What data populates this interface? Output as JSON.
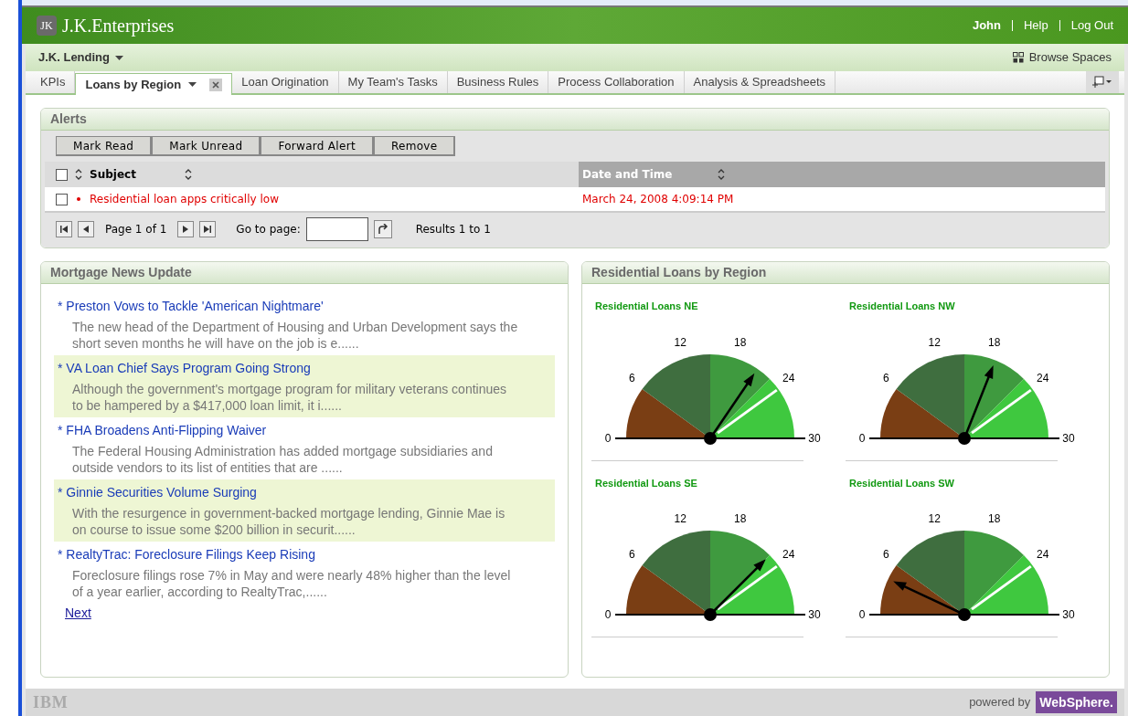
{
  "header": {
    "logo_mark": "JK",
    "brand": "J.K.Enterprises",
    "user": "John",
    "links": [
      "Help",
      "Log Out"
    ]
  },
  "space": {
    "title": "J.K. Lending",
    "browse": "Browse Spaces"
  },
  "tabs": [
    {
      "label": "KPIs",
      "selected": false
    },
    {
      "label": "Loans by Region",
      "selected": true
    },
    {
      "label": "Loan Origination",
      "selected": false
    },
    {
      "label": "My Team's Tasks",
      "selected": false
    },
    {
      "label": "Business Rules",
      "selected": false
    },
    {
      "label": "Process Collaboration",
      "selected": false
    },
    {
      "label": "Analysis & Spreadsheets",
      "selected": false
    }
  ],
  "alerts": {
    "title": "Alerts",
    "buttons": [
      "Mark Read",
      "Mark Unread",
      "Forward Alert",
      "Remove"
    ],
    "select_all": {
      "checked": false
    },
    "columns": [
      "Subject",
      "Date and Time"
    ],
    "rows": [
      {
        "checked": false,
        "subject": "Residential loan apps critically low",
        "date": "March 24, 2008 4:09:14 PM"
      }
    ],
    "pager": {
      "page": "Page 1 of 1",
      "goto": "Go to page:",
      "results": "Results 1 to 1"
    }
  },
  "news": {
    "title": "Mortgage News Update",
    "items": [
      {
        "title": "* Preston Vows to Tackle 'American Nightmare'",
        "summary": "The new head of the Department of Housing and Urban Development says the short seven months he will have on the job is e......"
      },
      {
        "title": "* VA Loan Chief Says Program Going Strong",
        "summary": "Although the government's mortgage program for military veterans continues to be hampered by a $417,000 loan limit, it i......"
      },
      {
        "title": "* FHA Broadens Anti-Flipping Waiver",
        "summary": "The Federal Housing Administration has added mortgage subsidiaries and outside vendors to its list of entities that are ......"
      },
      {
        "title": "* Ginnie Securities Volume Surging",
        "summary": "With the resurgence in government-backed mortgage lending, Ginnie Mae is on course to issue some $200 billion in securit......"
      },
      {
        "title": "* RealtyTrac: Foreclosure Filings Keep Rising",
        "summary": "Foreclosure filings rose 7% in May and were nearly 48% higher than the level of a year earlier, according to RealtyTrac,......"
      }
    ],
    "next": "Next"
  },
  "gauges": {
    "title": "Residential Loans by Region",
    "items": [
      {
        "title": "Residential Loans NE",
        "ticks": [
          "0",
          "6",
          "12",
          "18",
          "24",
          "30"
        ]
      },
      {
        "title": "Residential Loans NW",
        "ticks": [
          "0",
          "6",
          "12",
          "18",
          "24",
          "30"
        ]
      },
      {
        "title": "Residential Loans SE",
        "ticks": [
          "0",
          "6",
          "12",
          "18",
          "24",
          "30"
        ]
      },
      {
        "title": "Residential Loans SW",
        "ticks": [
          "0",
          "6",
          "12",
          "18",
          "24",
          "30"
        ]
      }
    ]
  },
  "footer": {
    "logo": "IBM",
    "powered": "powered by",
    "product": "WebSphere."
  }
}
